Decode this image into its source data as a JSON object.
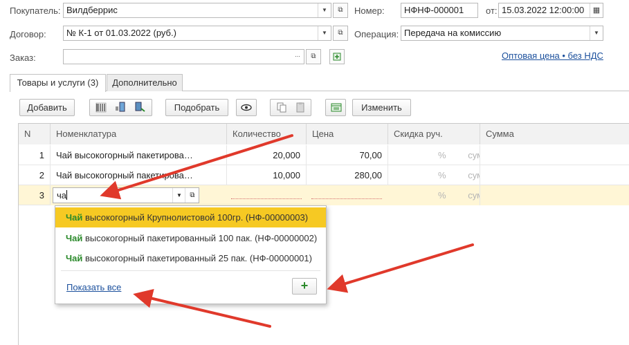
{
  "header": {
    "buyer": {
      "label": "Покупатель:",
      "value": "Вилдберрис"
    },
    "contract": {
      "label": "Договор:",
      "value": "№ К-1 от 01.03.2022 (руб.)"
    },
    "order": {
      "label": "Заказ:",
      "value": ""
    },
    "number": {
      "label": "Номер:",
      "value": "НФНФ-000001"
    },
    "date": {
      "label": "от:",
      "value": "15.03.2022 12:00:00"
    },
    "operation": {
      "label": "Операция:",
      "value": "Передача на комиссию"
    },
    "price_link": "Оптовая цена • без НДС"
  },
  "tabs": [
    {
      "label": "Товары и услуги (3)",
      "active": true
    },
    {
      "label": "Дополнительно",
      "active": false
    }
  ],
  "toolbar": {
    "add": "Добавить",
    "pick": "Подобрать",
    "change": "Изменить"
  },
  "table": {
    "columns": [
      "N",
      "Номенклатура",
      "Количество",
      "Цена",
      "Скидка руч.",
      "Сумма"
    ],
    "rows": [
      {
        "n": "1",
        "name": "Чай высокогорный пакетирова…",
        "qty": "20,000",
        "price": "70,00",
        "disc": "%",
        "sum": "сумма"
      },
      {
        "n": "2",
        "name": "Чай высокогорный пакетирова…",
        "qty": "10,000",
        "price": "280,00",
        "disc": "%",
        "sum": "сумма"
      },
      {
        "n": "3",
        "name": "ча",
        "qty": "",
        "price": "",
        "disc": "%",
        "sum": "сумма"
      }
    ]
  },
  "dropdown": {
    "items": [
      {
        "match": "Чай",
        "rest": " высокогорный Крупнолистовой 100гр. (НФ-00000003)",
        "selected": true
      },
      {
        "match": "Чай",
        "rest": " высокогорный пакетированный 100 пак. (НФ-00000002)",
        "selected": false
      },
      {
        "match": "Чай",
        "rest": " высокогорный пакетированный 25 пак. (НФ-00000001)",
        "selected": false
      }
    ],
    "show_all": "Показать все",
    "add_symbol": "+"
  },
  "colors": {
    "selected_row": "#fff6d6",
    "selected_item": "#f6c923",
    "arrow": "#e0392b",
    "plus": "#2b8a2b"
  },
  "icons": [
    "dropdown-arrow-icon",
    "open-form-icon",
    "barcode-icon",
    "scanner-icon",
    "terminal-icon",
    "eye-icon",
    "copy-icon",
    "paste-icon",
    "table-settings-icon",
    "plus-icon"
  ]
}
